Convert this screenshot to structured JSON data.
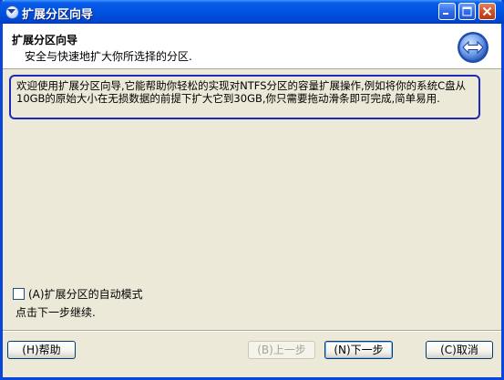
{
  "window": {
    "title": "扩展分区向导"
  },
  "header": {
    "title": "扩展分区向导",
    "subtitle": "安全与快速地扩大你所选择的分区."
  },
  "description": "欢迎使用扩展分区向导,它能帮助你轻松的实现对NTFS分区的容量扩展操作,例如将你的系统C盘从10GB的原始大小在无损数据的前提下扩大它到30GB,你只需要拖动滑条即可完成,简单易用.",
  "auto_mode": {
    "label": "(A)扩展分区的自动模式",
    "checked": false
  },
  "hint": "点击下一步继续.",
  "buttons": {
    "help": "(H)帮助",
    "back": "(B)上一步",
    "next": "(N)下一步",
    "cancel": "(C)取消"
  },
  "icons": {
    "title_icon": "minimize-arrow-icon",
    "header_icon": "left-right-arrows-icon"
  },
  "colors": {
    "titlebar": "#0054E3",
    "window_bg": "#ECE9D8",
    "description_border": "#1D29B8"
  }
}
